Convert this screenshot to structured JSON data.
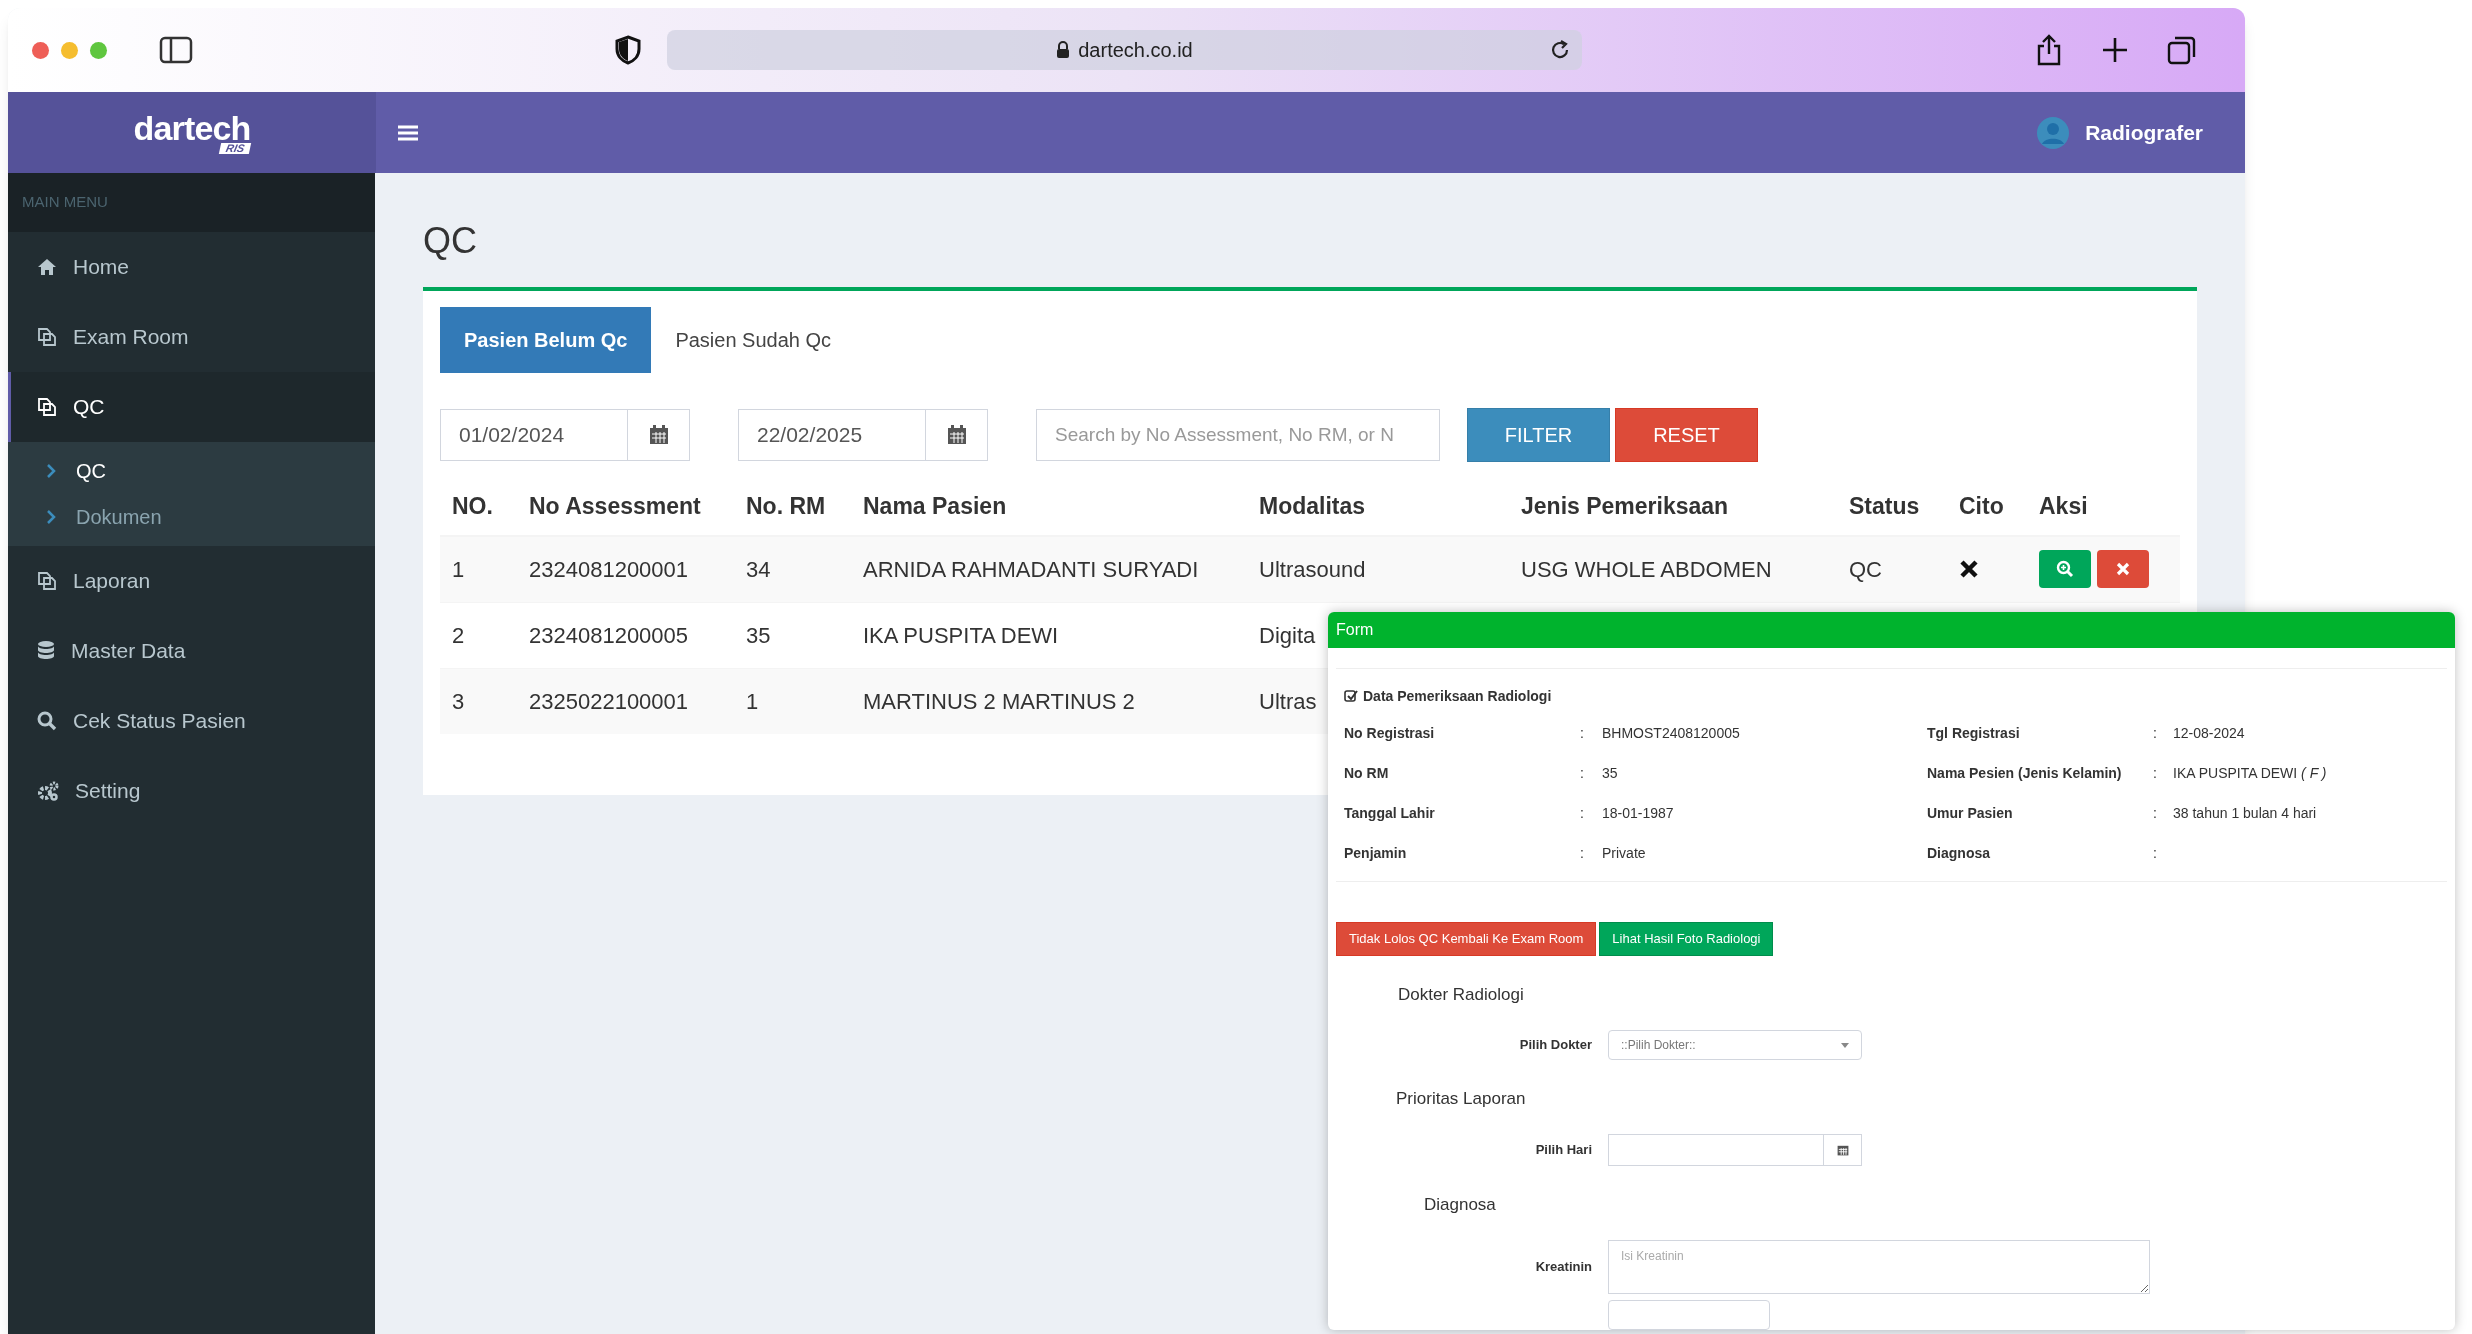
{
  "browser": {
    "url": "dartech.co.id"
  },
  "header": {
    "logo": "dartech",
    "logo_badge": "RIS",
    "user": "Radiografer"
  },
  "sidebar": {
    "section_label": "MAIN MENU",
    "items": [
      {
        "label": "Home",
        "selected": false
      },
      {
        "label": "Exam Room",
        "selected": false
      },
      {
        "label": "QC",
        "selected": true,
        "expanded": true,
        "children": [
          {
            "label": "QC",
            "selected": true
          },
          {
            "label": "Dokumen",
            "selected": false
          }
        ]
      },
      {
        "label": "Laporan",
        "selected": false
      },
      {
        "label": "Master Data",
        "selected": false
      },
      {
        "label": "Cek Status Pasien",
        "selected": false
      },
      {
        "label": "Setting",
        "selected": false
      }
    ]
  },
  "page": {
    "title": "QC",
    "tabs": [
      {
        "label": "Pasien Belum Qc",
        "selected": true
      },
      {
        "label": "Pasien Sudah Qc",
        "selected": false
      }
    ],
    "filters": {
      "date_from": "01/02/2024",
      "date_to": "22/02/2025",
      "search_placeholder": "Search by No Assessment, No RM, or N",
      "buttons": [
        {
          "label": "FILTER",
          "kind": "primary"
        },
        {
          "label": "RESET",
          "kind": "danger"
        }
      ]
    },
    "table": {
      "columns": [
        "NO.",
        "No Assessment",
        "No. RM",
        "Nama Pasien",
        "Modalitas",
        "Jenis Pemeriksaan",
        "Status",
        "Cito",
        "Aksi"
      ],
      "rows": [
        {
          "cells": [
            "1",
            "2324081200001",
            "34",
            "ARNIDA RAHMADANTI SURYADI",
            "Ultrasound",
            "USG WHOLE ABDOMEN",
            "QC"
          ],
          "cito": false,
          "actions": true
        },
        {
          "cells": [
            "2",
            "2324081200005",
            "35",
            "IKA PUSPITA DEWI",
            "Digita"
          ]
        },
        {
          "cells": [
            "3",
            "2325022100001",
            "1",
            "MARTINUS 2 MARTINUS 2",
            "Ultras"
          ]
        }
      ]
    }
  },
  "form": {
    "title": "Form",
    "section_title": "Data Pemeriksaan Radiologi",
    "fields": [
      {
        "label": "No Registrasi",
        "separator": ":",
        "value": "BHMOST2408120005"
      },
      {
        "label": "Tgl Registrasi",
        "separator": ":",
        "value": "12-08-2024"
      },
      {
        "label": "No RM",
        "separator": ":",
        "value": "35"
      },
      {
        "label": "Nama Pesien (Jenis Kelamin)",
        "separator": ":",
        "value": "IKA PUSPITA DEWI *( F )*"
      },
      {
        "label": "Tanggal Lahir",
        "separator": ":",
        "value": "18-01-1987"
      },
      {
        "label": "Umur Pasien",
        "separator": ":",
        "value": "38 tahun 1 bulan 4 hari"
      },
      {
        "label": "Penjamin",
        "separator": ":",
        "value": "Private"
      },
      {
        "label": "Diagnosa",
        "separator": ":"
      }
    ],
    "buttons": [
      {
        "label": "Tidak Lolos QC Kembali Ke Exam Room",
        "kind": "danger"
      },
      {
        "label": "Lihat Hasil Foto Radiologi",
        "kind": "success"
      }
    ],
    "groups": [
      {
        "heading": "Dokter Radiologi",
        "field": {
          "label": "Pilih Dokter",
          "kind": "select",
          "value": "::Pilih Dokter::"
        }
      },
      {
        "heading": "Prioritas Laporan",
        "field": {
          "label": "Pilih Hari",
          "kind": "date"
        }
      },
      {
        "heading": "Diagnosa",
        "field": {
          "label": "Kreatinin",
          "kind": "textarea",
          "placeholder": "Isi Kreatinin"
        }
      }
    ]
  }
}
